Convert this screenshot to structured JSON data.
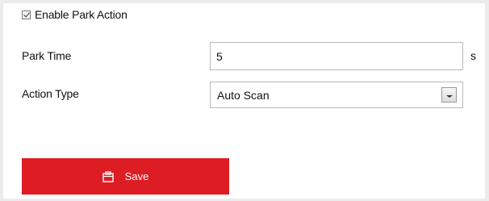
{
  "park_action": {
    "enable_label": "Enable Park Action",
    "enabled": true
  },
  "park_time": {
    "label": "Park Time",
    "value": "5",
    "unit": "s"
  },
  "action_type": {
    "label": "Action Type",
    "selected": "Auto Scan"
  },
  "save": {
    "label": "Save",
    "icon": "save-icon",
    "color": "#de1c24"
  }
}
